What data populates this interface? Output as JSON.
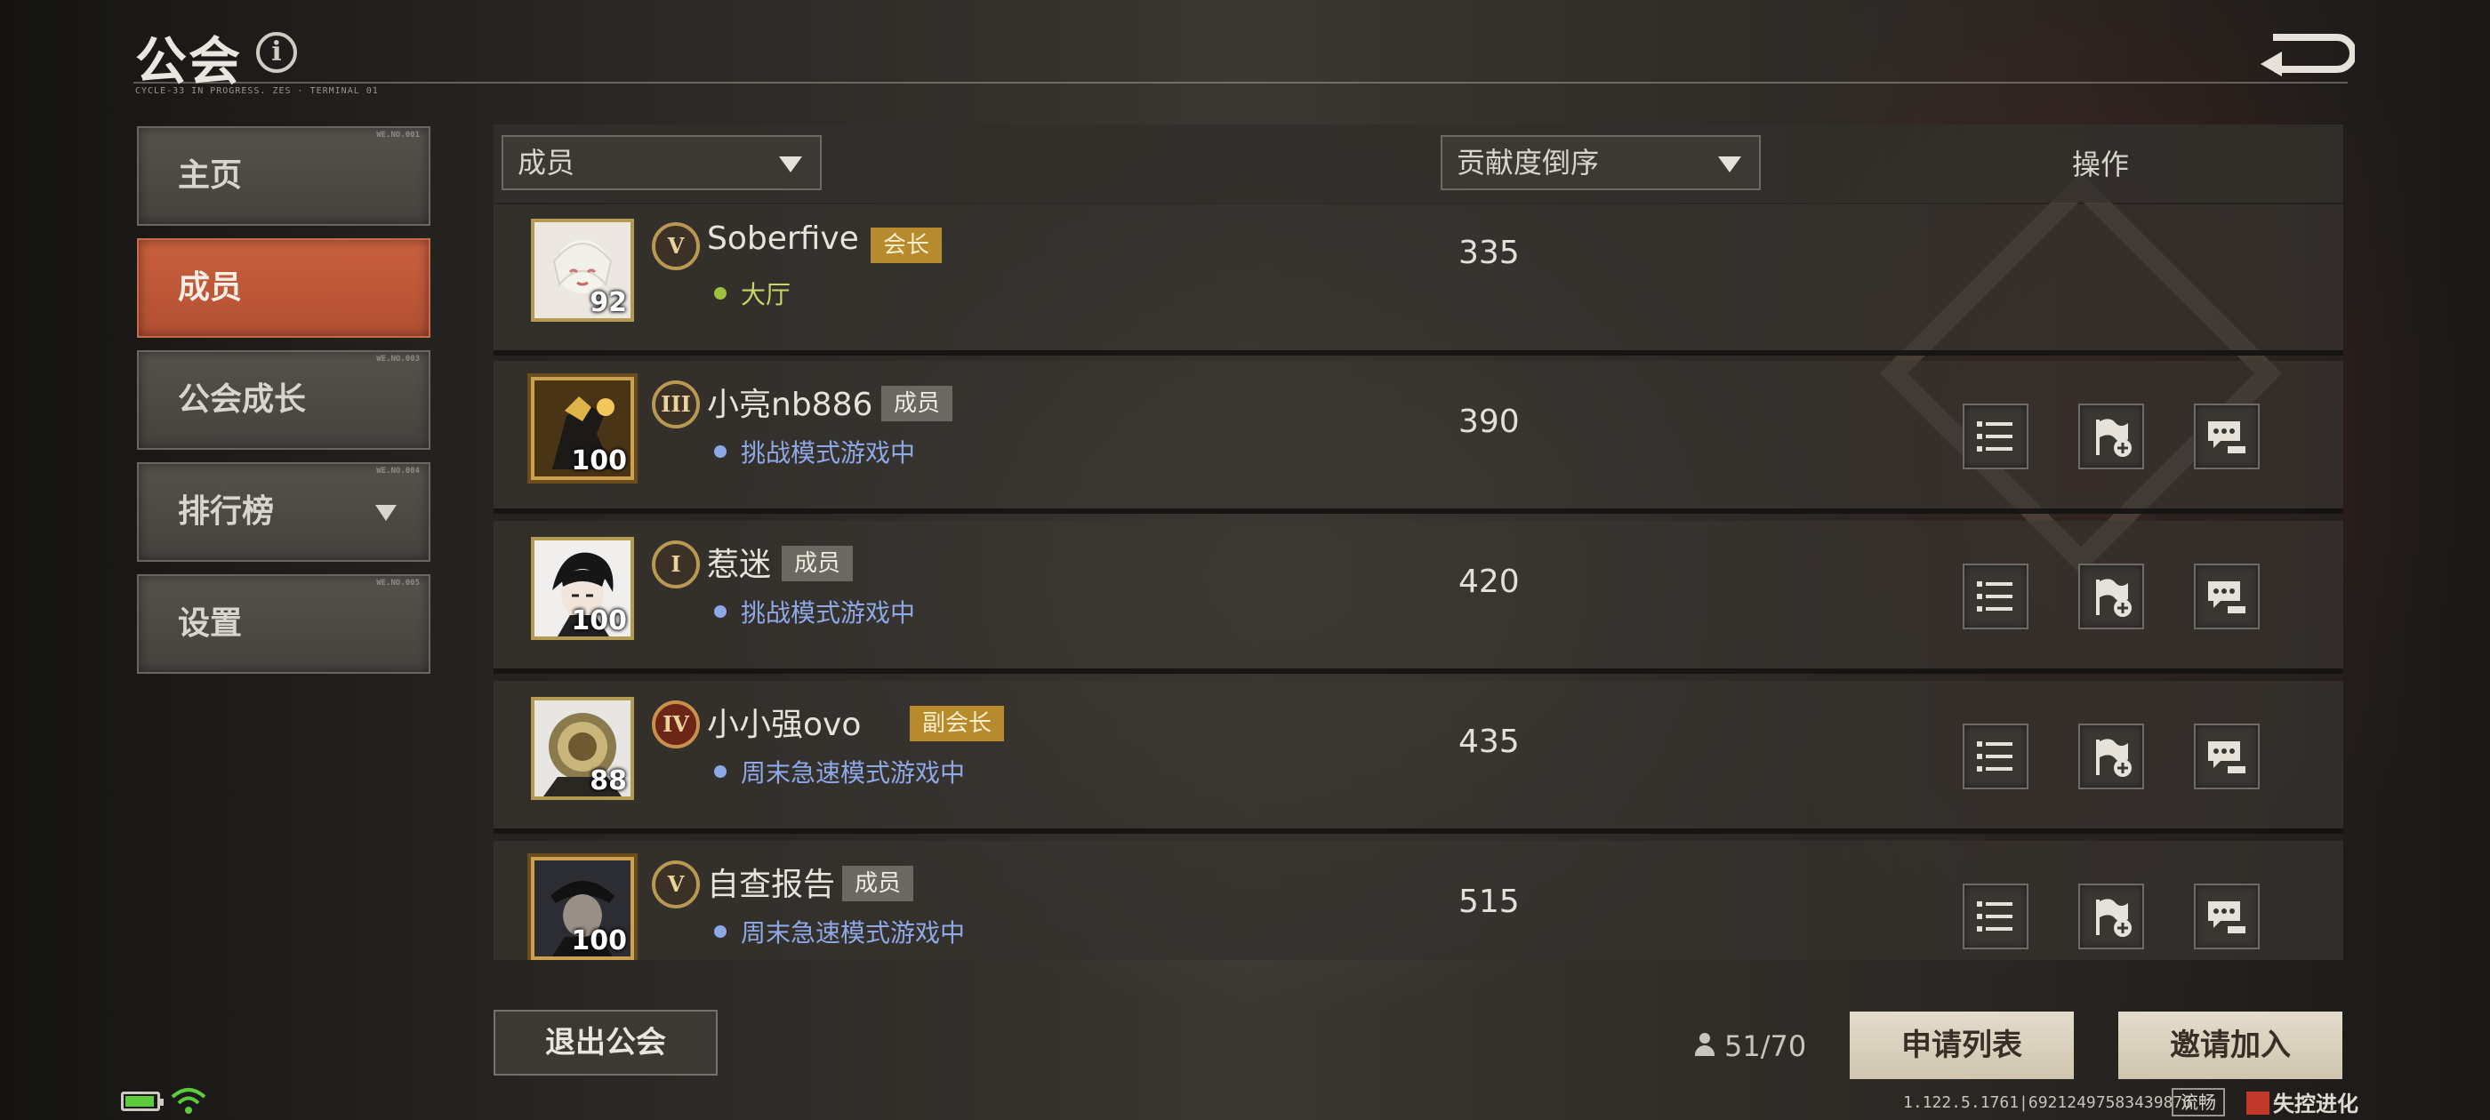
{
  "header": {
    "title": "公会",
    "subtitle": "CYCLE-33 IN PROGRESS.  ZES · TERMINAL 01",
    "info_icon": "info-icon",
    "back_icon": "return-arrow-icon"
  },
  "sidebar": {
    "items": [
      {
        "label": "主页",
        "active": false,
        "tag": "WE.NO.001"
      },
      {
        "label": "成员",
        "active": true,
        "tag": ""
      },
      {
        "label": "公会成长",
        "active": false,
        "tag": "WE.NO.003"
      },
      {
        "label": "排行榜",
        "active": false,
        "tag": "WE.NO.004",
        "has_dropdown": true
      },
      {
        "label": "设置",
        "active": false,
        "tag": "WE.NO.005"
      }
    ]
  },
  "table": {
    "filter_dropdown": "成员",
    "sort_dropdown": "贡献度倒序",
    "ops_header": "操作",
    "rows": [
      {
        "level": "92",
        "rank": "V",
        "name": "Soberfive",
        "role": "会长",
        "role_style": "gold",
        "status": "大厅",
        "status_color": "#9cbf3c",
        "score": "335",
        "has_ops": false
      },
      {
        "level": "100",
        "rank": "III",
        "name": "小亮nb886",
        "role": "成员",
        "role_style": "gray",
        "status": "挑战模式游戏中",
        "status_color": "#8fa8e6",
        "score": "390",
        "has_ops": true
      },
      {
        "level": "100",
        "rank": "I",
        "name": "惹迷",
        "role": "成员",
        "role_style": "gray",
        "status": "挑战模式游戏中",
        "status_color": "#8fa8e6",
        "score": "420",
        "has_ops": true
      },
      {
        "level": "88",
        "rank": "IV",
        "name": "小小强ovo",
        "role": "副会长",
        "role_style": "gold",
        "status": "周末急速模式游戏中",
        "status_color": "#8fa8e6",
        "score": "435",
        "has_ops": true
      },
      {
        "level": "100",
        "rank": "V",
        "name": "自查报告",
        "role": "成员",
        "role_style": "gray",
        "status": "周末急速模式游戏中",
        "status_color": "#8fa8e6",
        "score": "515",
        "has_ops": true
      }
    ],
    "op_icons": [
      "list-icon",
      "flag-add-icon",
      "chat-add-icon"
    ]
  },
  "footer": {
    "leave_button": "退出公会",
    "member_count": "51/70",
    "apply_list_button": "申请列表",
    "invite_button": "邀请加入",
    "version": "1.122.5.1761|69212497583439876",
    "quality_tag": "流畅",
    "logo_text": "失控进化"
  },
  "colors": {
    "accent_active": "#c9603e",
    "status_blue": "#8fa8e6",
    "status_green": "#9cbf3c",
    "role_gold": "#b78a2e"
  }
}
